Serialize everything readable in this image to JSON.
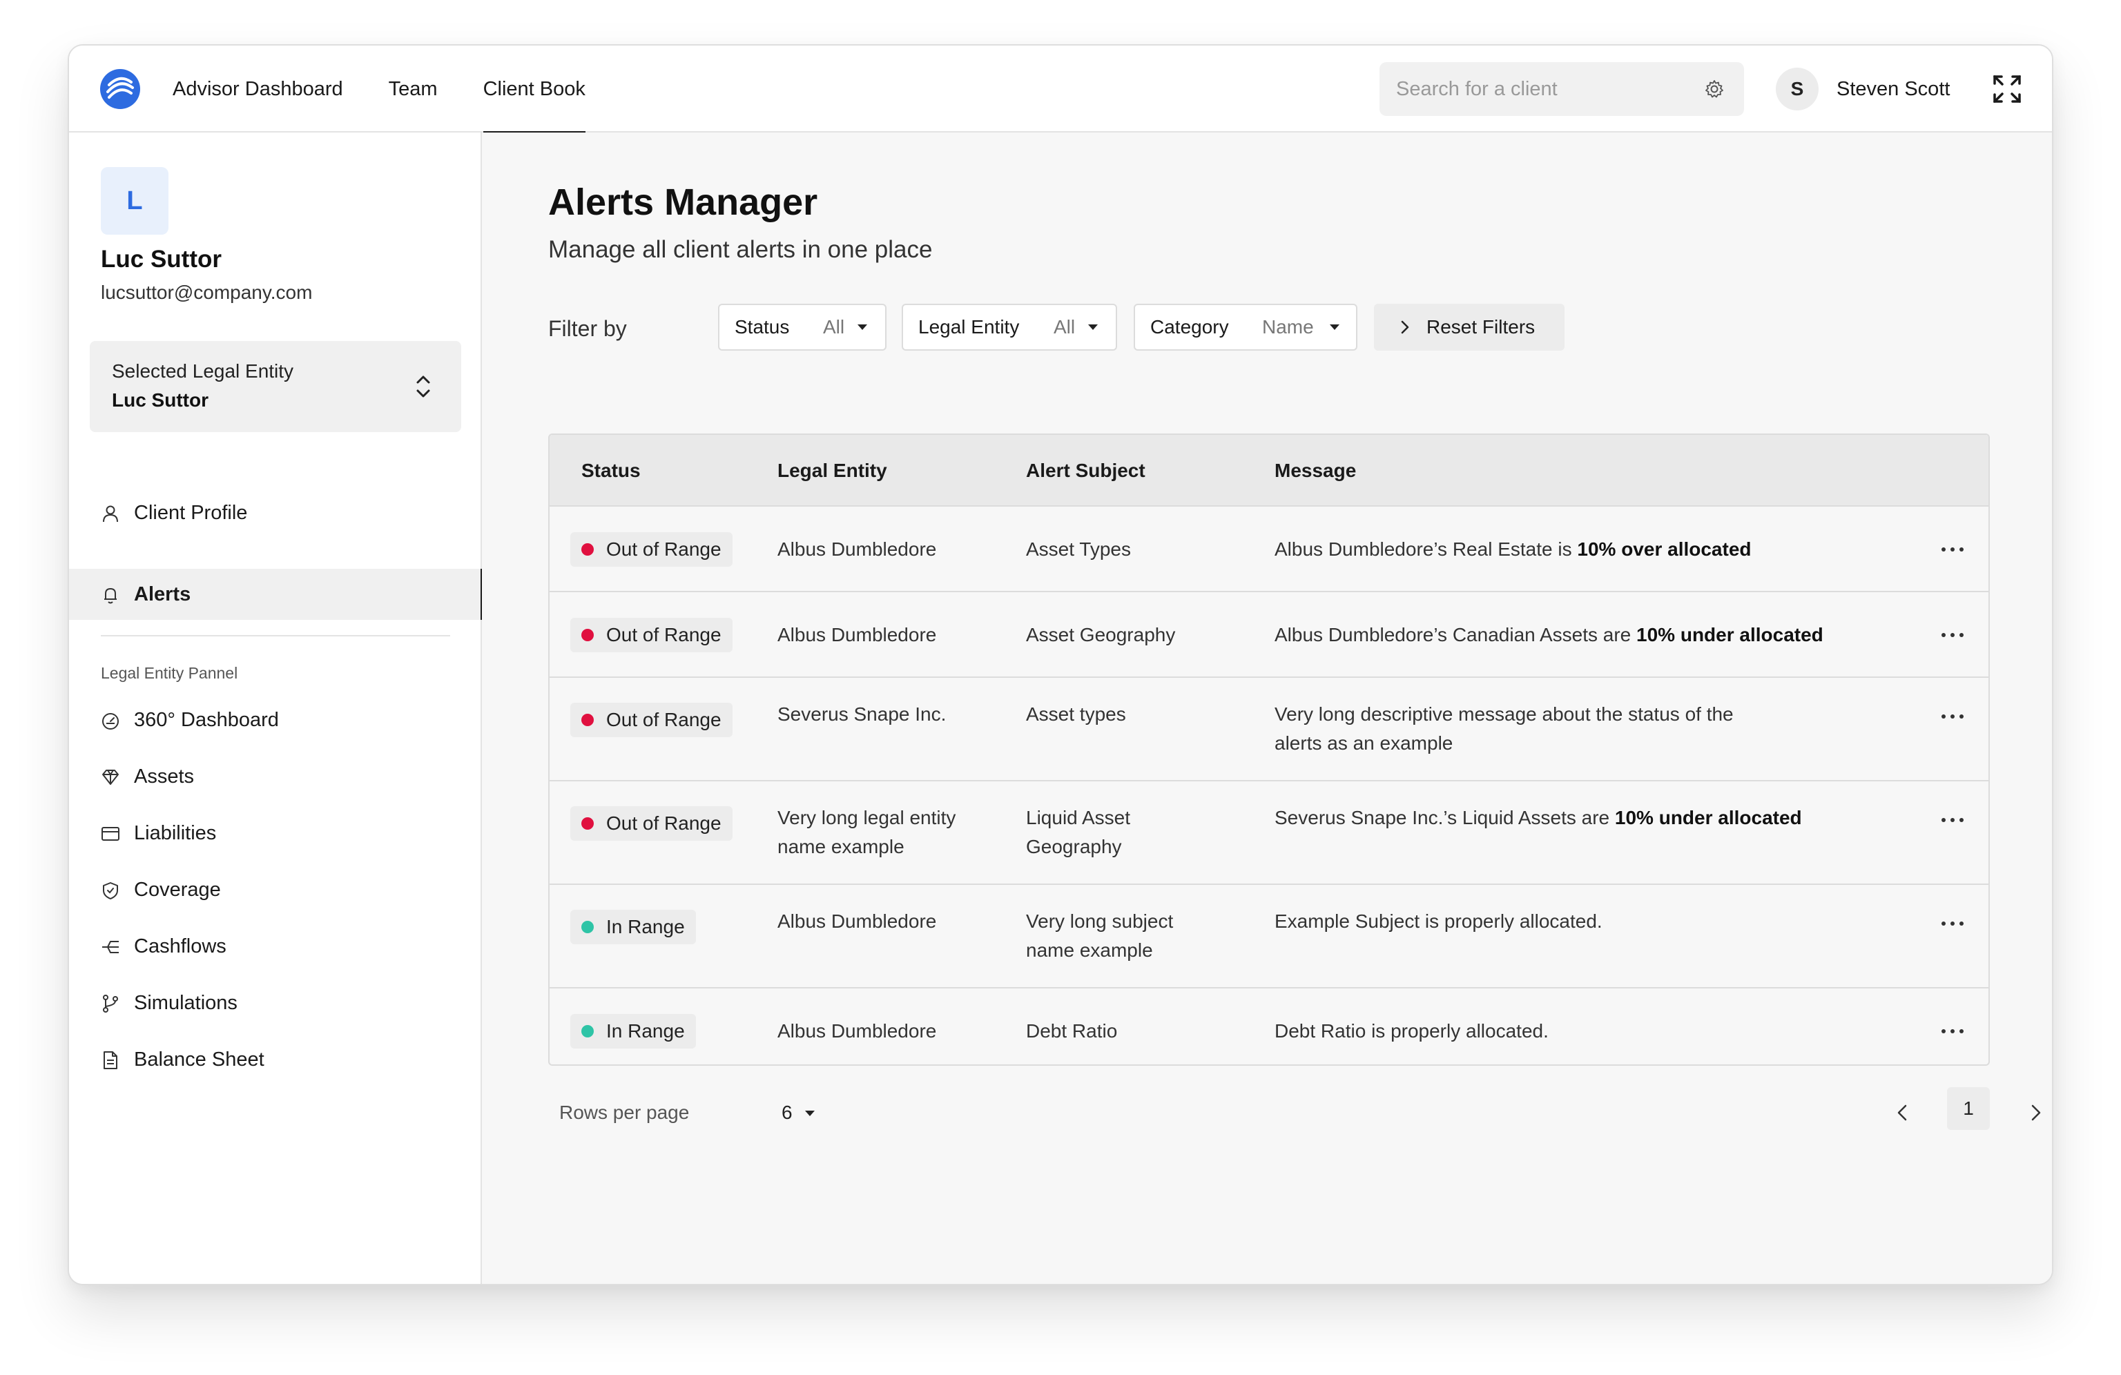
{
  "nav": {
    "items": [
      {
        "label": "Advisor Dashboard",
        "active": false
      },
      {
        "label": "Team",
        "active": false
      },
      {
        "label": "Client Book",
        "active": true
      }
    ],
    "search_placeholder": "Search for a client",
    "user": {
      "initial": "S",
      "name": "Steven Scott"
    }
  },
  "sidebar": {
    "client": {
      "initial": "L",
      "name": "Luc Suttor",
      "email": "lucsuttor@company.com"
    },
    "entity_select": {
      "label": "Selected Legal Entity",
      "value": "Luc Suttor"
    },
    "top_items": [
      {
        "label": "Client Profile",
        "icon": "user-icon"
      },
      {
        "label": "Alerts",
        "icon": "bell-icon",
        "active": true
      }
    ],
    "section_title": "Legal Entity Pannel",
    "panel_items": [
      {
        "label": "360° Dashboard",
        "icon": "gauge-icon"
      },
      {
        "label": "Assets",
        "icon": "diamond-icon"
      },
      {
        "label": "Liabilities",
        "icon": "credit-card-icon"
      },
      {
        "label": "Coverage",
        "icon": "shield-icon"
      },
      {
        "label": "Cashflows",
        "icon": "flow-icon"
      },
      {
        "label": "Simulations",
        "icon": "branch-icon"
      },
      {
        "label": "Balance Sheet",
        "icon": "document-icon"
      }
    ]
  },
  "main": {
    "title": "Alerts Manager",
    "subtitle": "Manage all client alerts in one place",
    "filter_label": "Filter by",
    "filters": [
      {
        "name": "Status",
        "value": "All"
      },
      {
        "name": "Legal Entity",
        "value": "All"
      },
      {
        "name": "Category",
        "value": "Name"
      }
    ],
    "reset_label": "Reset Filters",
    "columns": [
      "Status",
      "Legal Entity",
      "Alert Subject",
      "Message"
    ],
    "rows": [
      {
        "status": "Out of Range",
        "status_color": "#e0103f",
        "entity": [
          "Albus Dumbledore"
        ],
        "subject": [
          "Asset Types"
        ],
        "message": [
          {
            "t": "Albus Dumbledore’s Real Estate is "
          },
          {
            "t": "10% over allocated",
            "b": true
          }
        ]
      },
      {
        "status": "Out of Range",
        "status_color": "#e0103f",
        "entity": [
          "Albus Dumbledore"
        ],
        "subject": [
          "Asset Geography"
        ],
        "message": [
          {
            "t": "Albus Dumbledore’s Canadian Assets are "
          },
          {
            "t": "10% under allocated",
            "b": true
          }
        ]
      },
      {
        "status": "Out of Range",
        "status_color": "#e0103f",
        "entity": [
          "Severus Snape Inc."
        ],
        "subject": [
          "Asset types"
        ],
        "message": [
          {
            "t": "Very long descriptive message about the status of the"
          },
          {
            "br": true
          },
          {
            "t": "alerts as an example"
          }
        ]
      },
      {
        "status": "Out of Range",
        "status_color": "#e0103f",
        "entity": [
          "Very long legal entity",
          "name example"
        ],
        "subject": [
          "Liquid Asset",
          "Geography"
        ],
        "message": [
          {
            "t": "Severus Snape Inc.’s Liquid Assets are "
          },
          {
            "t": "10% under allocated",
            "b": true
          }
        ]
      },
      {
        "status": "In Range",
        "status_color": "#2ec4a6",
        "entity": [
          "Albus Dumbledore"
        ],
        "subject": [
          "Very long subject",
          "name example"
        ],
        "message": [
          {
            "t": "Example Subject is properly allocated."
          }
        ]
      },
      {
        "status": "In Range",
        "status_color": "#2ec4a6",
        "entity": [
          "Albus Dumbledore"
        ],
        "subject": [
          "Debt Ratio"
        ],
        "message": [
          {
            "t": "Debt Ratio is properly allocated."
          }
        ]
      }
    ],
    "pagination": {
      "rows_per_page_label": "Rows per page",
      "rows_per_page": "6",
      "current_page": "1"
    }
  }
}
